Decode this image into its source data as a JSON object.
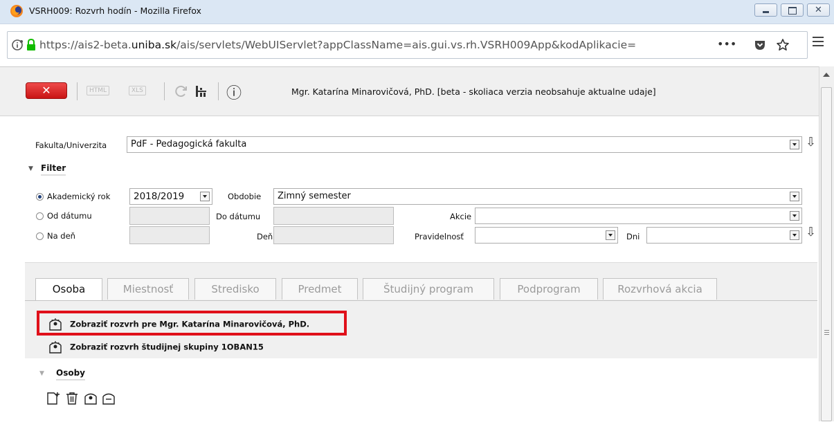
{
  "window": {
    "title": "VSRH009: Rozvrh hodín - Mozilla Firefox",
    "url_prefix": "https://ais2-beta.",
    "url_domain": "uniba.sk",
    "url_suffix": "/ais/servlets/WebUIServlet?appClassName=ais.gui.vs.rh.VSRH009App&kodAplikacie=",
    "url_overflow": "•••"
  },
  "toolbar": {
    "close_label": "✕",
    "html_label": "HTML",
    "xls_label": "XLS",
    "info_label": "ⓘ",
    "user_info": "Mgr. Katarína Minarovičová, PhD. [beta - skoliaca verzia neobsahuje aktualne udaje]"
  },
  "form": {
    "faculty_label": "Fakulta/Univerzita",
    "faculty_value": "PdF - Pedagogická fakulta",
    "filter_title": "Filter",
    "academic_year_label": "Akademický rok",
    "academic_year_value": "2018/2019",
    "period_label": "Obdobie",
    "period_value": "Zimný semester",
    "from_date_label": "Od dátumu",
    "to_date_label": "Do dátumu",
    "action_label": "Akcie",
    "on_day_label": "Na deň",
    "day_label": "Deň",
    "regularity_label": "Pravidelnosť",
    "days_label": "Dni"
  },
  "tabs": [
    {
      "label": "Osoba"
    },
    {
      "label": "Miestnosť"
    },
    {
      "label": "Stredisko"
    },
    {
      "label": "Predmet"
    },
    {
      "label": "Študijný program"
    },
    {
      "label": "Podprogram"
    },
    {
      "label": "Rozvrhová akcia"
    }
  ],
  "panel": {
    "link_person": "Zobraziť rozvrh pre Mgr. Katarína Minarovičová, PhD.",
    "link_group": "Zobraziť rozvrh študijnej skupiny 1OBAN15",
    "persons_title": "Osoby"
  },
  "colors": {
    "close_button": "#d91c1c",
    "highlight": "#e0101a"
  }
}
